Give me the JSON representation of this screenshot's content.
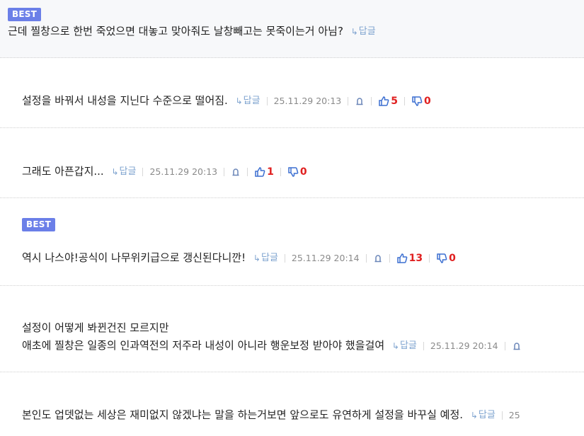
{
  "badge_best": "BEST",
  "reply_label": "답글",
  "colors": {
    "best_bg": "#6b7fe8",
    "reply": "#7ea3cf",
    "count": "#e02020",
    "thumb": "#3b6fd1"
  },
  "comments": [
    {
      "best": true,
      "lines": [
        "근데 찔창으로 한번 죽었으면 대놓고 맞아줘도 날창빼고는 못죽이는거 아님?"
      ],
      "date": "",
      "up": "",
      "down": ""
    },
    {
      "best": false,
      "lines": [
        "설정을 바꿔서 내성을 지닌다 수준으로 떨어짐."
      ],
      "date": "25.11.29 20:13",
      "up": "5",
      "down": "0"
    },
    {
      "best": false,
      "lines": [
        "그래도 아픈갑지..."
      ],
      "date": "25.11.29 20:13",
      "up": "1",
      "down": "0"
    },
    {
      "best": true,
      "lines": [
        "역시 나스야!공식이 나무위키급으로 갱신된다니깐!"
      ],
      "date": "25.11.29 20:14",
      "up": "13",
      "down": "0"
    },
    {
      "best": false,
      "lines": [
        "설정이 어떻게 봐뀐건진 모르지만",
        "애초에 찔창은 일종의 인과역전의 저주라 내성이 아니라 행운보정 받아야 했을걸여"
      ],
      "date": "25.11.29 20:14",
      "up": "",
      "down": ""
    },
    {
      "best": false,
      "lines": [
        "본인도 업뎃없는 세상은 재미없지 않겠냐는 말을 하는거보면 앞으로도 유연하게 설정을 바꾸실 예정."
      ],
      "date": "25",
      "up": "",
      "down": ""
    }
  ]
}
